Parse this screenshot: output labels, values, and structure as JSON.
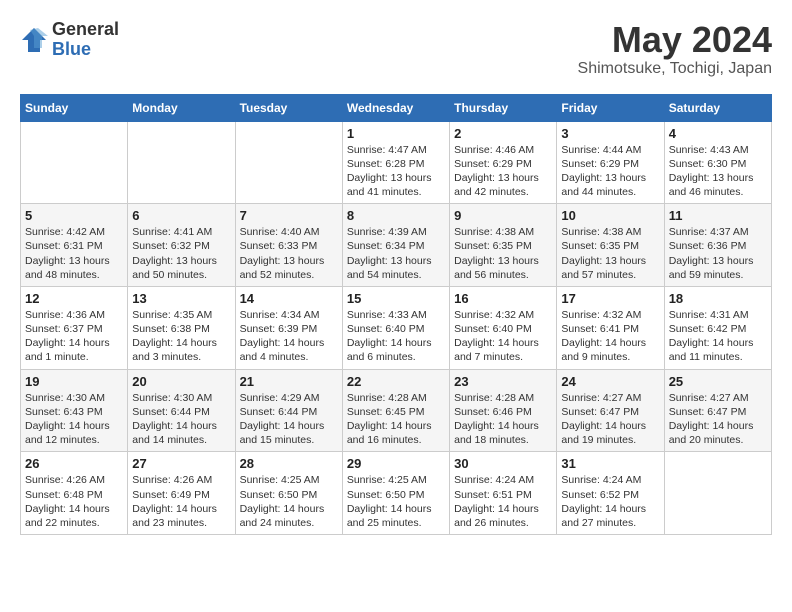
{
  "header": {
    "logo_general": "General",
    "logo_blue": "Blue",
    "month": "May 2024",
    "location": "Shimotsuke, Tochigi, Japan"
  },
  "weekdays": [
    "Sunday",
    "Monday",
    "Tuesday",
    "Wednesday",
    "Thursday",
    "Friday",
    "Saturday"
  ],
  "weeks": [
    [
      {
        "day": "",
        "info": ""
      },
      {
        "day": "",
        "info": ""
      },
      {
        "day": "",
        "info": ""
      },
      {
        "day": "1",
        "info": "Sunrise: 4:47 AM\nSunset: 6:28 PM\nDaylight: 13 hours\nand 41 minutes."
      },
      {
        "day": "2",
        "info": "Sunrise: 4:46 AM\nSunset: 6:29 PM\nDaylight: 13 hours\nand 42 minutes."
      },
      {
        "day": "3",
        "info": "Sunrise: 4:44 AM\nSunset: 6:29 PM\nDaylight: 13 hours\nand 44 minutes."
      },
      {
        "day": "4",
        "info": "Sunrise: 4:43 AM\nSunset: 6:30 PM\nDaylight: 13 hours\nand 46 minutes."
      }
    ],
    [
      {
        "day": "5",
        "info": "Sunrise: 4:42 AM\nSunset: 6:31 PM\nDaylight: 13 hours\nand 48 minutes."
      },
      {
        "day": "6",
        "info": "Sunrise: 4:41 AM\nSunset: 6:32 PM\nDaylight: 13 hours\nand 50 minutes."
      },
      {
        "day": "7",
        "info": "Sunrise: 4:40 AM\nSunset: 6:33 PM\nDaylight: 13 hours\nand 52 minutes."
      },
      {
        "day": "8",
        "info": "Sunrise: 4:39 AM\nSunset: 6:34 PM\nDaylight: 13 hours\nand 54 minutes."
      },
      {
        "day": "9",
        "info": "Sunrise: 4:38 AM\nSunset: 6:35 PM\nDaylight: 13 hours\nand 56 minutes."
      },
      {
        "day": "10",
        "info": "Sunrise: 4:38 AM\nSunset: 6:35 PM\nDaylight: 13 hours\nand 57 minutes."
      },
      {
        "day": "11",
        "info": "Sunrise: 4:37 AM\nSunset: 6:36 PM\nDaylight: 13 hours\nand 59 minutes."
      }
    ],
    [
      {
        "day": "12",
        "info": "Sunrise: 4:36 AM\nSunset: 6:37 PM\nDaylight: 14 hours\nand 1 minute."
      },
      {
        "day": "13",
        "info": "Sunrise: 4:35 AM\nSunset: 6:38 PM\nDaylight: 14 hours\nand 3 minutes."
      },
      {
        "day": "14",
        "info": "Sunrise: 4:34 AM\nSunset: 6:39 PM\nDaylight: 14 hours\nand 4 minutes."
      },
      {
        "day": "15",
        "info": "Sunrise: 4:33 AM\nSunset: 6:40 PM\nDaylight: 14 hours\nand 6 minutes."
      },
      {
        "day": "16",
        "info": "Sunrise: 4:32 AM\nSunset: 6:40 PM\nDaylight: 14 hours\nand 7 minutes."
      },
      {
        "day": "17",
        "info": "Sunrise: 4:32 AM\nSunset: 6:41 PM\nDaylight: 14 hours\nand 9 minutes."
      },
      {
        "day": "18",
        "info": "Sunrise: 4:31 AM\nSunset: 6:42 PM\nDaylight: 14 hours\nand 11 minutes."
      }
    ],
    [
      {
        "day": "19",
        "info": "Sunrise: 4:30 AM\nSunset: 6:43 PM\nDaylight: 14 hours\nand 12 minutes."
      },
      {
        "day": "20",
        "info": "Sunrise: 4:30 AM\nSunset: 6:44 PM\nDaylight: 14 hours\nand 14 minutes."
      },
      {
        "day": "21",
        "info": "Sunrise: 4:29 AM\nSunset: 6:44 PM\nDaylight: 14 hours\nand 15 minutes."
      },
      {
        "day": "22",
        "info": "Sunrise: 4:28 AM\nSunset: 6:45 PM\nDaylight: 14 hours\nand 16 minutes."
      },
      {
        "day": "23",
        "info": "Sunrise: 4:28 AM\nSunset: 6:46 PM\nDaylight: 14 hours\nand 18 minutes."
      },
      {
        "day": "24",
        "info": "Sunrise: 4:27 AM\nSunset: 6:47 PM\nDaylight: 14 hours\nand 19 minutes."
      },
      {
        "day": "25",
        "info": "Sunrise: 4:27 AM\nSunset: 6:47 PM\nDaylight: 14 hours\nand 20 minutes."
      }
    ],
    [
      {
        "day": "26",
        "info": "Sunrise: 4:26 AM\nSunset: 6:48 PM\nDaylight: 14 hours\nand 22 minutes."
      },
      {
        "day": "27",
        "info": "Sunrise: 4:26 AM\nSunset: 6:49 PM\nDaylight: 14 hours\nand 23 minutes."
      },
      {
        "day": "28",
        "info": "Sunrise: 4:25 AM\nSunset: 6:50 PM\nDaylight: 14 hours\nand 24 minutes."
      },
      {
        "day": "29",
        "info": "Sunrise: 4:25 AM\nSunset: 6:50 PM\nDaylight: 14 hours\nand 25 minutes."
      },
      {
        "day": "30",
        "info": "Sunrise: 4:24 AM\nSunset: 6:51 PM\nDaylight: 14 hours\nand 26 minutes."
      },
      {
        "day": "31",
        "info": "Sunrise: 4:24 AM\nSunset: 6:52 PM\nDaylight: 14 hours\nand 27 minutes."
      },
      {
        "day": "",
        "info": ""
      }
    ]
  ]
}
